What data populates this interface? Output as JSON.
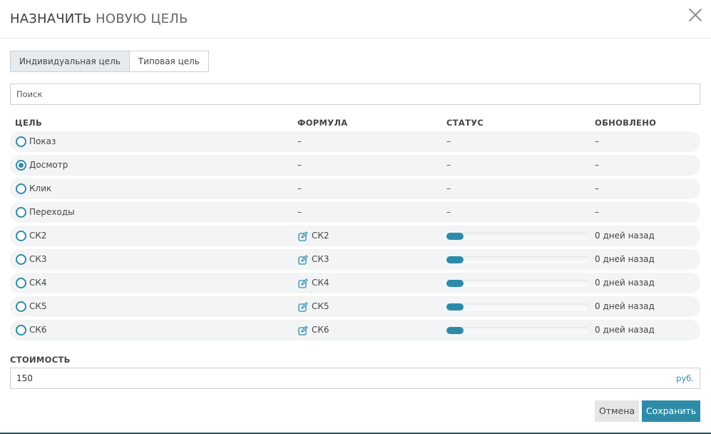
{
  "dialog": {
    "title_bold": "НАЗНАЧИТЬ",
    "title_rest": "НОВУЮ ЦЕЛЬ"
  },
  "tabs": [
    {
      "label": "Индивидуальная цель",
      "active": true
    },
    {
      "label": "Типовая цель",
      "active": false
    }
  ],
  "search": {
    "placeholder": "Поиск",
    "value": ""
  },
  "table": {
    "headers": {
      "goal": "ЦЕЛЬ",
      "formula": "ФОРМУЛА",
      "status": "СТАТУС",
      "updated": "ОБНОВЛЕНО"
    },
    "rows": [
      {
        "name": "Показ",
        "formula": "–",
        "status": "–",
        "updated": "–",
        "selected": false
      },
      {
        "name": "Досмотр",
        "formula": "–",
        "status": "–",
        "updated": "–",
        "selected": true
      },
      {
        "name": "Клик",
        "formula": "–",
        "status": "–",
        "updated": "–",
        "selected": false
      },
      {
        "name": "Переходы",
        "formula": "–",
        "status": "–",
        "updated": "–",
        "selected": false
      },
      {
        "name": "СК2",
        "formula": "СК2",
        "formula_icon": "edit-icon",
        "progress": 0.12,
        "updated": "0 дней назад",
        "selected": false
      },
      {
        "name": "СК3",
        "formula": "СК3",
        "formula_icon": "edit-icon",
        "progress": 0.12,
        "updated": "0 дней назад",
        "selected": false
      },
      {
        "name": "СК4",
        "formula": "СК4",
        "formula_icon": "edit-icon",
        "progress": 0.12,
        "updated": "0 дней назад",
        "selected": false
      },
      {
        "name": "СК5",
        "formula": "СК5",
        "formula_icon": "edit-icon",
        "progress": 0.12,
        "updated": "0 дней назад",
        "selected": false
      },
      {
        "name": "СК6",
        "formula": "СК6",
        "formula_icon": "edit-icon",
        "progress": 0.12,
        "updated": "0 дней назад",
        "selected": false
      }
    ]
  },
  "cost": {
    "label": "СТОИМОСТЬ",
    "value": "150",
    "unit": "руб."
  },
  "buttons": {
    "cancel": "Отмена",
    "save": "Сохранить"
  },
  "colors": {
    "accent": "#2e8ba8",
    "row_bg": "#f3f4f5",
    "active_tab_bg": "#e6ebf0"
  }
}
